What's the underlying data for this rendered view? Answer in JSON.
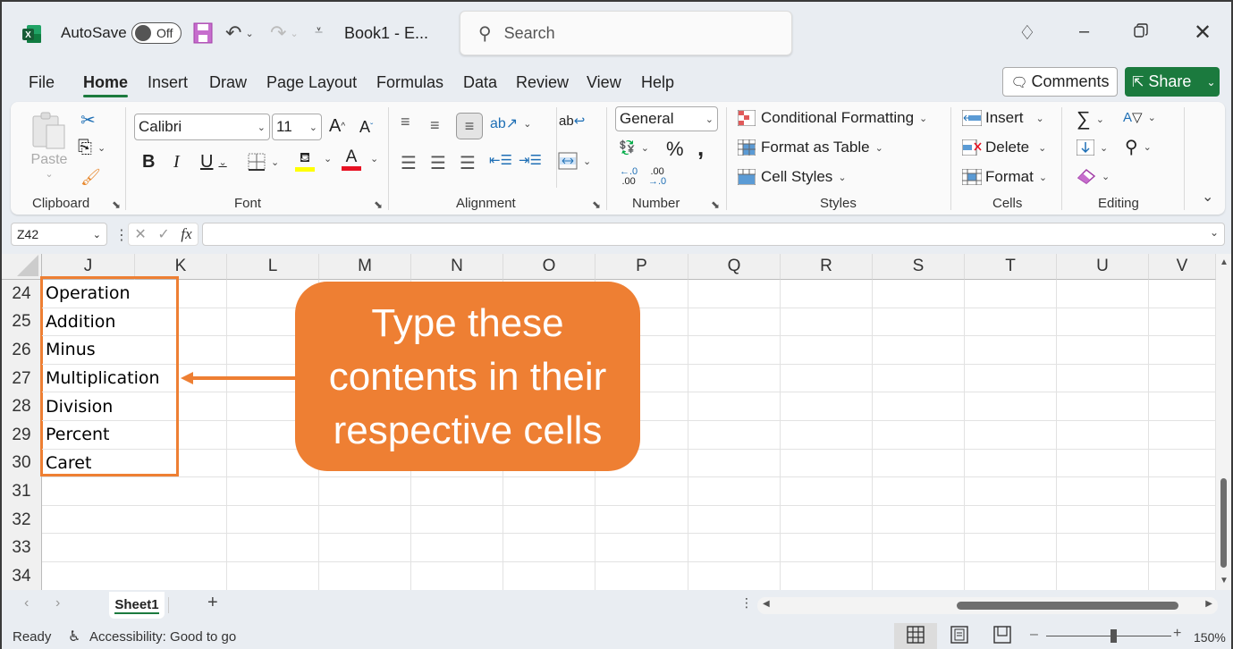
{
  "titlebar": {
    "app_icon": "excel-icon",
    "autosave_label": "AutoSave",
    "autosave_state": "Off",
    "document_title": "Book1  -  E...",
    "search_placeholder": "Search",
    "icons": [
      "save-icon",
      "undo-icon",
      "redo-icon",
      "customize-qat-icon",
      "diamond-icon",
      "minimize-icon",
      "restore-icon",
      "close-icon"
    ]
  },
  "menu": {
    "items": [
      "File",
      "Home",
      "Insert",
      "Draw",
      "Page Layout",
      "Formulas",
      "Data",
      "Review",
      "View",
      "Help"
    ],
    "active": "Home",
    "comments_label": "Comments",
    "share_label": "Share"
  },
  "ribbon": {
    "clipboard": {
      "label": "Clipboard",
      "paste_label": "Paste"
    },
    "font": {
      "label": "Font",
      "font_name": "Calibri",
      "font_size": "11",
      "bold": "B",
      "italic": "I",
      "underline": "U",
      "grow": "A",
      "shrink": "A",
      "fill_color": "#ffff00",
      "font_color": "#ff0000"
    },
    "alignment": {
      "label": "Alignment"
    },
    "number": {
      "label": "Number",
      "format": "General",
      "percent": "%",
      "comma": "̗",
      "inc_decimal": "←.0 .00",
      "dec_decimal": ".00 →.0"
    },
    "styles": {
      "label": "Styles",
      "conditional_formatting": "Conditional Formatting",
      "format_as_table": "Format as Table",
      "cell_styles": "Cell Styles"
    },
    "cells": {
      "label": "Cells",
      "insert": "Insert",
      "delete": "Delete",
      "format": "Format"
    },
    "editing": {
      "label": "Editing"
    }
  },
  "formula_bar": {
    "name_box": "Z42",
    "formula": ""
  },
  "grid": {
    "columns": [
      "J",
      "K",
      "L",
      "M",
      "N",
      "O",
      "P",
      "Q",
      "R",
      "S",
      "T",
      "U",
      "V"
    ],
    "rows": [
      "24",
      "25",
      "26",
      "27",
      "28",
      "29",
      "30",
      "31",
      "32",
      "33",
      "34"
    ],
    "cells_J": [
      "Operation",
      "Addition",
      "Minus",
      "Multiplication",
      "Division",
      "Percent",
      "Caret",
      "",
      "",
      "",
      ""
    ]
  },
  "annotation": {
    "callout_text": "Type these contents in their respective cells",
    "line1": "Type these",
    "line2": "contents in their",
    "line3": "respective cells",
    "color": "#ee7f33"
  },
  "sheets": {
    "tabs": [
      "Sheet1"
    ],
    "active": "Sheet1",
    "add_label": "+"
  },
  "status": {
    "ready": "Ready",
    "accessibility": "Accessibility: Good to go",
    "zoom": "150%"
  }
}
